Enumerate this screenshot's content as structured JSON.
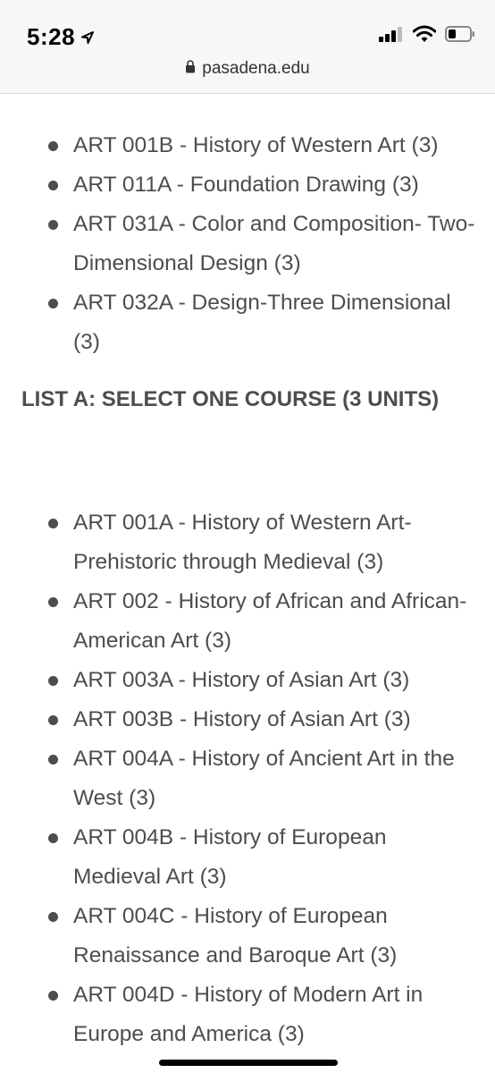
{
  "status_bar": {
    "time": "5:28"
  },
  "browser": {
    "url": "pasadena.edu"
  },
  "list_top": [
    "ART 001B - History of Western Art (3)",
    "ART 011A - Foundation Drawing (3)",
    "ART 031A - Color and Composition- Two-Dimensional Design (3)",
    "ART 032A - Design-Three Dimensional (3)"
  ],
  "section": {
    "heading": "LIST A: SELECT ONE COURSE (3 UNITS)"
  },
  "list_a": [
    "ART 001A - History of Western Art- Prehistoric through Medieval (3)",
    "ART 002 - History of African and African-American Art (3)",
    "ART 003A - History of Asian Art (3)",
    "ART 003B - History of Asian Art (3)",
    "ART 004A - History of Ancient Art in the West (3)",
    "ART 004B - History of European Medieval Art (3)",
    "ART 004C - History of European Renaissance and Baroque Art (3)",
    "ART 004D - History of Modern Art in Europe and America (3)"
  ]
}
